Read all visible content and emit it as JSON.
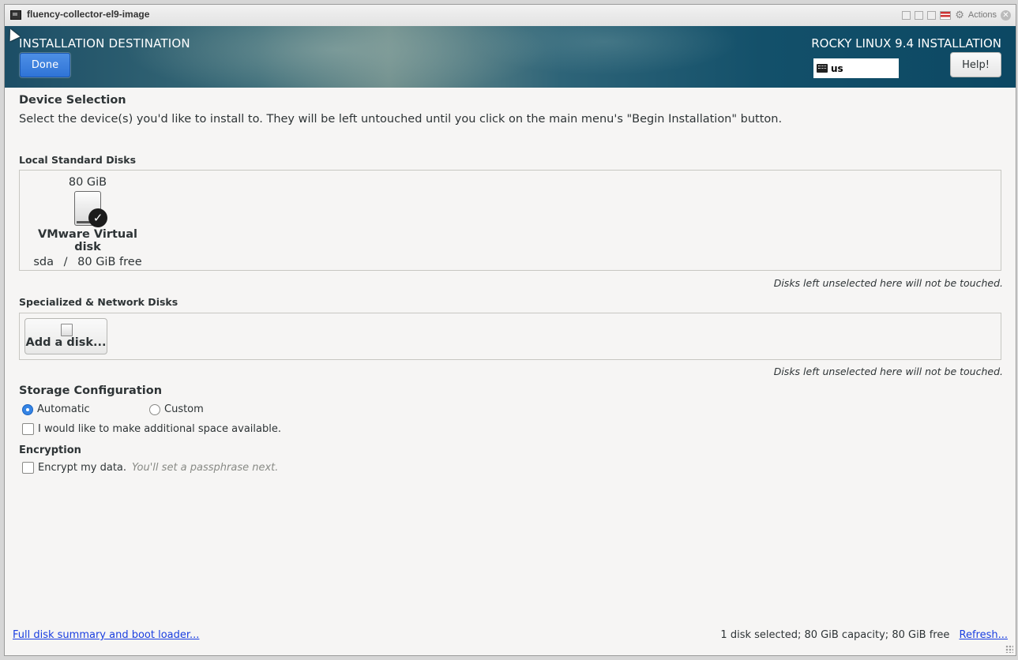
{
  "window": {
    "title": "fluency-collector-el9-image",
    "actions_label": "Actions"
  },
  "header": {
    "title": "INSTALLATION DESTINATION",
    "done_label": "Done",
    "product_title": "ROCKY LINUX 9.4 INSTALLATION",
    "keyboard_layout": "us",
    "help_label": "Help!"
  },
  "device_selection": {
    "heading": "Device Selection",
    "description": "Select the device(s) you'd like to install to.  They will be left untouched until you click on the main menu's \"Begin Installation\" button."
  },
  "local_disks": {
    "heading": "Local Standard Disks",
    "disks": [
      {
        "size": "80 GiB",
        "name": "VMware Virtual disk",
        "device": "sda",
        "separator": "/",
        "free": "80 GiB free",
        "selected": true
      }
    ],
    "note": "Disks left unselected here will not be touched."
  },
  "network_disks": {
    "heading": "Specialized & Network Disks",
    "add_label": "Add a disk...",
    "note": "Disks left unselected here will not be touched."
  },
  "storage": {
    "heading": "Storage Configuration",
    "options": [
      {
        "label": "Automatic",
        "selected": true
      },
      {
        "label": "Custom",
        "selected": false
      }
    ],
    "extra_space_label": "I would like to make additional space available."
  },
  "encryption": {
    "heading": "Encryption",
    "encrypt_label": "Encrypt my data.",
    "hint": "You'll set a passphrase next."
  },
  "footer": {
    "summary_link": "Full disk summary and boot loader...",
    "status": "1 disk selected; 80 GiB capacity; 80 GiB free",
    "refresh_link": "Refresh..."
  },
  "colors": {
    "accent": "#3584e4",
    "link": "#1a3ee0",
    "header_bg": "#13506a"
  }
}
